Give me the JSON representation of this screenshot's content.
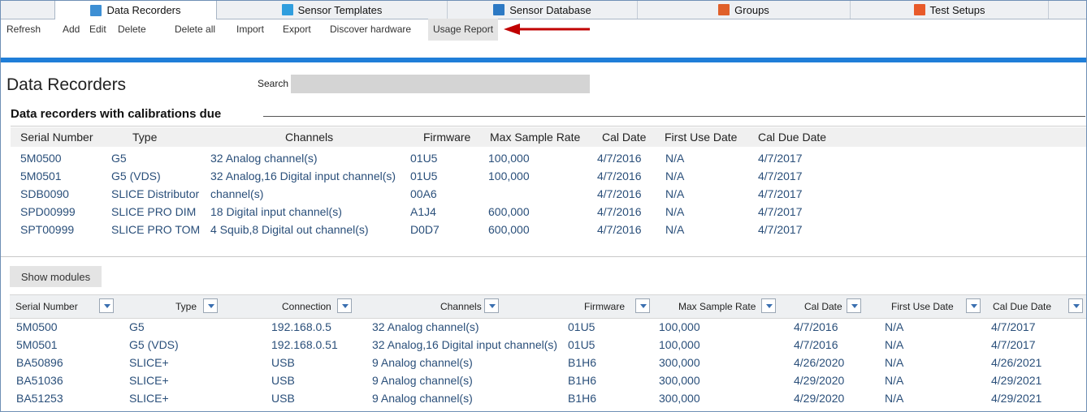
{
  "tabs": [
    {
      "label": "Data Recorders",
      "icon": "data-recorders-icon"
    },
    {
      "label": "Sensor Templates",
      "icon": "sensor-templates-icon"
    },
    {
      "label": "Sensor Database",
      "icon": "sensor-database-icon"
    },
    {
      "label": "Groups",
      "icon": "groups-icon"
    },
    {
      "label": "Test Setups",
      "icon": "test-setups-icon"
    }
  ],
  "toolbar": {
    "refresh": "Refresh",
    "add": "Add",
    "edit": "Edit",
    "delete": "Delete",
    "delete_all": "Delete all",
    "import": "Import",
    "export": "Export",
    "discover": "Discover hardware",
    "usage_report": "Usage Report"
  },
  "colors": {
    "accent_bar": "#1f7ed8",
    "annotation_arrow": "#c00000",
    "link_text": "#2a4f7a"
  },
  "page_title": "Data Recorders",
  "search": {
    "label": "Search",
    "value": ""
  },
  "due_section": {
    "title": "Data recorders with calibrations due",
    "headers": [
      "Serial Number",
      "Type",
      "Channels",
      "Firmware",
      "Max Sample Rate",
      "Cal Date",
      "First Use Date",
      "Cal Due Date"
    ],
    "rows": [
      [
        "5M0500",
        "G5",
        "32 Analog channel(s)",
        "01U5",
        "100,000",
        "4/7/2016",
        "N/A",
        "4/7/2017"
      ],
      [
        "5M0501",
        "G5 (VDS)",
        "32 Analog,16 Digital input channel(s)",
        "01U5",
        "100,000",
        "4/7/2016",
        "N/A",
        "4/7/2017"
      ],
      [
        "SDB0090",
        "SLICE Distributor",
        " channel(s)",
        "00A6",
        "",
        "4/7/2016",
        "N/A",
        "4/7/2017"
      ],
      [
        "SPD00999",
        "SLICE PRO DIM",
        "18 Digital input channel(s)",
        "A1J4",
        "600,000",
        "4/7/2016",
        "N/A",
        "4/7/2017"
      ],
      [
        "SPT00999",
        "SLICE PRO TOM",
        "4 Squib,8 Digital out channel(s)",
        "D0D7",
        "600,000",
        "4/7/2016",
        "N/A",
        "4/7/2017"
      ]
    ]
  },
  "show_modules_label": "Show modules",
  "main_table": {
    "headers": [
      "Serial Number",
      "Type",
      "Connection",
      "Channels",
      "Firmware",
      "Max Sample Rate",
      "Cal Date",
      "First Use Date",
      "Cal Due Date"
    ],
    "rows": [
      [
        "5M0500",
        "G5",
        "192.168.0.5",
        "32 Analog channel(s)",
        "01U5",
        "100,000",
        "4/7/2016",
        "N/A",
        "4/7/2017"
      ],
      [
        "5M0501",
        "G5 (VDS)",
        "192.168.0.51",
        "32 Analog,16 Digital input channel(s)",
        "01U5",
        "100,000",
        "4/7/2016",
        "N/A",
        "4/7/2017"
      ],
      [
        "BA50896",
        "SLICE+",
        "USB",
        "9 Analog channel(s)",
        "B1H6",
        "300,000",
        "4/26/2020",
        "N/A",
        "4/26/2021"
      ],
      [
        "BA51036",
        "SLICE+",
        "USB",
        "9 Analog channel(s)",
        "B1H6",
        "300,000",
        "4/29/2020",
        "N/A",
        "4/29/2021"
      ],
      [
        "BA51253",
        "SLICE+",
        "USB",
        "9 Analog channel(s)",
        "B1H6",
        "300,000",
        "4/29/2020",
        "N/A",
        "4/29/2021"
      ]
    ]
  }
}
